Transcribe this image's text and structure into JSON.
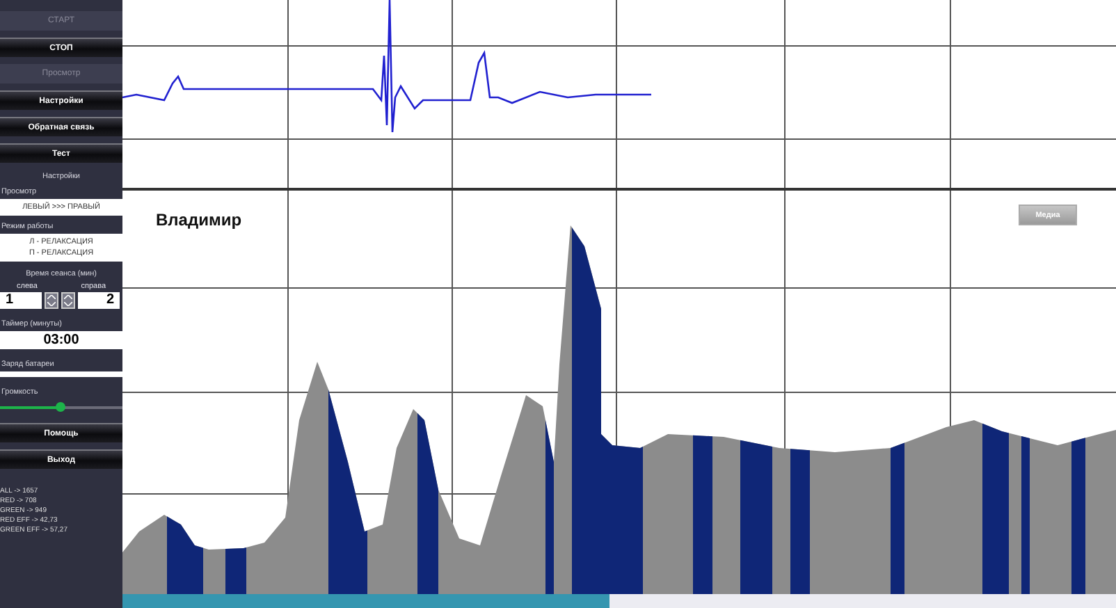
{
  "sidebar": {
    "buttons_top": [
      {
        "label": "СТАРТ",
        "disabled": true
      },
      {
        "label": "СТОП",
        "disabled": false
      },
      {
        "label": "Просмотр",
        "disabled": true
      },
      {
        "label": "Настройки",
        "disabled": false
      },
      {
        "label": "Обратная связь",
        "disabled": false
      },
      {
        "label": "Тест",
        "disabled": false
      }
    ],
    "settings_heading": "Настройки",
    "view_label": "Просмотр",
    "view_value": "ЛЕВЫЙ >>> ПРАВЫЙ",
    "mode_label": "Режим работы",
    "mode_lines": [
      "Л - РЕЛАКСАЦИЯ",
      "П - РЕЛАКСАЦИЯ"
    ],
    "session_label": "Время сеанса (мин)",
    "left": {
      "label": "слева",
      "value": "1"
    },
    "right": {
      "label": "справа",
      "value": "2"
    },
    "timer_label": "Таймер (минуты)",
    "timer_value": "03:00",
    "battery_label": "Заряд батареи",
    "volume": {
      "label": "Громкость",
      "level": 0.49
    },
    "buttons_bottom": [
      {
        "label": "Помощь",
        "disabled": false
      },
      {
        "label": "Выход",
        "disabled": false
      }
    ],
    "stats": [
      "ALL -> 1657",
      "RED -> 708",
      "GREEN -> 949",
      "RED EFF -> 42,73",
      "GREEN EFF -> 57,27"
    ]
  },
  "chart": {
    "title": "Владимир",
    "button": "Медиа"
  },
  "progress": {
    "level": 0.49
  }
}
